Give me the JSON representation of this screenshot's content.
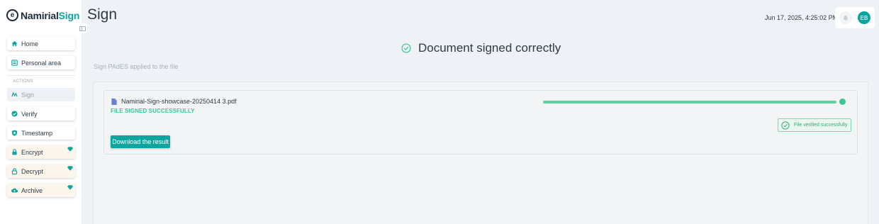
{
  "app": {
    "logo_mark": "e",
    "brand_first": "Namirial",
    "brand_second": "Sign",
    "accent_color": "#0ea5a0",
    "success_color": "#3cc793"
  },
  "sidebar": {
    "collapse_icon": "sidebar-collapse-icon",
    "items": [
      {
        "label": "Home",
        "icon": "home-icon"
      },
      {
        "label": "Personal area",
        "icon": "id-card-icon"
      }
    ],
    "section_label": "ACTIONS",
    "actions": [
      {
        "label": "Sign",
        "icon": "signature-icon",
        "active": true,
        "premium": false
      },
      {
        "label": "Verify",
        "icon": "check-circle-icon",
        "active": false,
        "premium": false
      },
      {
        "label": "Timestamp",
        "icon": "shield-icon",
        "active": false,
        "premium": false
      },
      {
        "label": "Encrypt",
        "icon": "lock-icon",
        "active": false,
        "premium": true
      },
      {
        "label": "Decrypt",
        "icon": "unlock-icon",
        "active": false,
        "premium": true
      },
      {
        "label": "Archive",
        "icon": "cloud-upload-icon",
        "active": false,
        "premium": true
      }
    ]
  },
  "header": {
    "title": "Sign",
    "timestamp": "Jun 17, 2025, 4:25:02 PM",
    "avatar_initials": "EB"
  },
  "main": {
    "success_title": "Document signed correctly",
    "subtitle": "Sign PAdES applied to the file",
    "file": {
      "name": "Namirial-Sign-showcase-20250414 3.pdf",
      "status": "FILE SIGNED SUCCESSFULLY",
      "progress": 1.0,
      "verified_label": "File verified successfully"
    },
    "download_label": "Download the result"
  }
}
